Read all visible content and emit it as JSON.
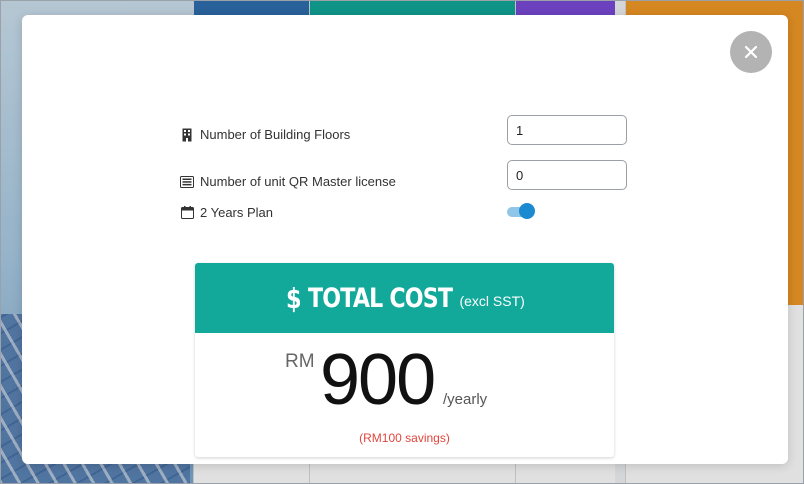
{
  "background": {
    "accent_colors": [
      "#2f6fb0",
      "#12a99a",
      "#7b4bd9",
      "#f39a26"
    ]
  },
  "modal": {
    "close_icon": "close-icon",
    "fields": {
      "floors": {
        "label": "Number of Building Floors",
        "value": "1",
        "icon": "building-icon"
      },
      "license": {
        "label": "Number of unit QR Master license",
        "value": "0",
        "icon": "list-icon"
      },
      "plan": {
        "label": "2 Years Plan",
        "enabled": true,
        "icon": "calendar-icon"
      }
    },
    "cost": {
      "symbol": "$",
      "title": "TOTAL COST",
      "note": "(excl SST)",
      "currency": "RM",
      "amount": "900",
      "period": "/yearly",
      "savings": "(RM100 savings)",
      "header_color": "#12a99a",
      "savings_color": "#e0463d"
    }
  }
}
